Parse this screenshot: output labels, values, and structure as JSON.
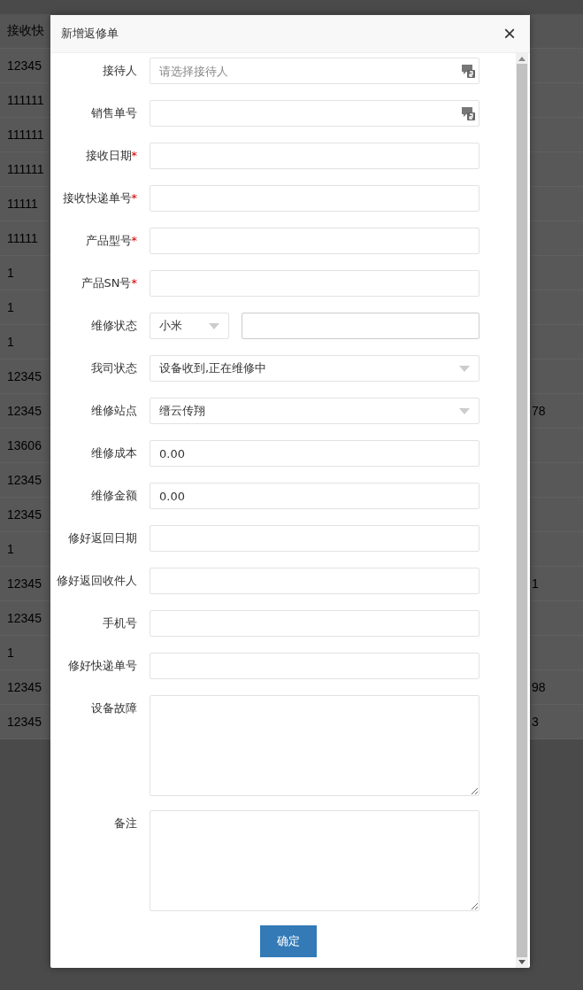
{
  "background_table": {
    "header": {
      "column_1": "接收快"
    },
    "rows": [
      {
        "column_1": "12345"
      },
      {
        "column_1": "111111"
      },
      {
        "column_1": "111111"
      },
      {
        "column_1": "111111"
      },
      {
        "column_1": "11111"
      },
      {
        "column_1": "11111"
      },
      {
        "column_1": "1"
      },
      {
        "column_1": "1"
      },
      {
        "column_1": "1"
      },
      {
        "column_1": "12345"
      },
      {
        "column_1": "12345",
        "column_2": "78"
      },
      {
        "column_1": "13606"
      },
      {
        "column_1": "12345"
      },
      {
        "column_1": "12345"
      },
      {
        "column_1": "1"
      },
      {
        "column_1": "12345",
        "column_2": "1"
      },
      {
        "column_1": "12345"
      },
      {
        "column_1": "1"
      },
      {
        "column_1": "12345",
        "column_2": "98"
      },
      {
        "column_1": "12345",
        "column_2": "3"
      }
    ]
  },
  "dialog": {
    "title": "新增返修单",
    "close": "×",
    "fields": [
      {
        "kind": "picker",
        "label": "接待人",
        "required": false,
        "placeholder": "请选择接待人"
      },
      {
        "kind": "picker",
        "label": "销售单号",
        "required": false
      },
      {
        "kind": "text",
        "label": "接收日期",
        "required": true
      },
      {
        "kind": "text",
        "label": "接收快递单号",
        "required": true
      },
      {
        "kind": "text",
        "label": "产品型号",
        "required": true
      },
      {
        "kind": "text",
        "label": "产品SN号",
        "required": true
      },
      {
        "kind": "dual",
        "label": "维修状态",
        "required": false,
        "value": "小米"
      },
      {
        "kind": "select",
        "label": "我司状态",
        "required": false,
        "value": "设备收到,正在维修中"
      },
      {
        "kind": "select",
        "label": "维修站点",
        "required": false,
        "value": "缙云传翔"
      },
      {
        "kind": "text",
        "label": "维修成本",
        "required": false,
        "value": "0.00"
      },
      {
        "kind": "text",
        "label": "维修金额",
        "required": false,
        "value": "0.00"
      },
      {
        "kind": "text",
        "label": "修好返回日期",
        "required": false
      },
      {
        "kind": "text",
        "label": "修好返回收件人",
        "required": false
      },
      {
        "kind": "text",
        "label": "手机号",
        "required": false
      },
      {
        "kind": "text",
        "label": "修好快递单号",
        "required": false
      },
      {
        "kind": "textarea",
        "label": "设备故障",
        "required": false
      },
      {
        "kind": "textarea",
        "label": "备注",
        "required": false
      }
    ],
    "required_mark": "*",
    "confirm_button": "确定"
  }
}
